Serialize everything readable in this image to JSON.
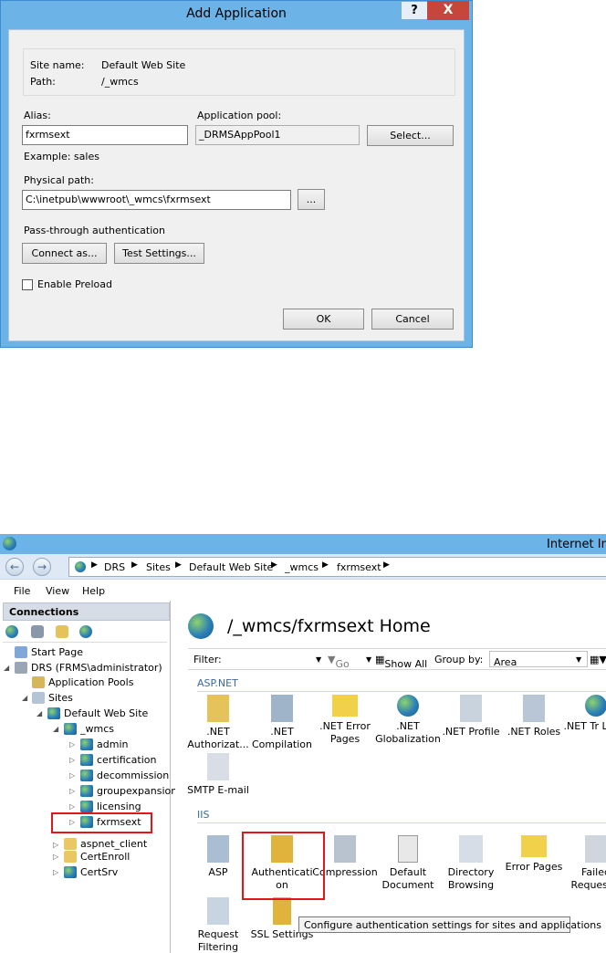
{
  "dialog": {
    "title": "Add Application",
    "help_label": "?",
    "close_label": "X",
    "site_name_label": "Site name:",
    "site_name_value": "Default Web Site",
    "path_label": "Path:",
    "path_value": "/_wmcs",
    "alias_label": "Alias:",
    "alias_value": "fxrmsext",
    "app_pool_label": "Application pool:",
    "app_pool_value": "_DRMSAppPool1",
    "select_button": "Select...",
    "example_text": "Example: sales",
    "physical_path_label": "Physical path:",
    "physical_path_value": "C:\\inetpub\\wwwroot\\_wmcs\\fxrmsext",
    "browse_button": "...",
    "passthrough_label": "Pass-through authentication",
    "connect_as_button": "Connect as...",
    "test_settings_button": "Test Settings...",
    "enable_preload_label": "Enable Preload",
    "enable_preload_checked": false,
    "ok_button": "OK",
    "cancel_button": "Cancel"
  },
  "iis": {
    "window_title": "Internet Inf",
    "breadcrumb": [
      "DRS",
      "Sites",
      "Default Web Site",
      "_wmcs",
      "fxrmsext"
    ],
    "menu": [
      "File",
      "View",
      "Help"
    ],
    "connections_title": "Connections",
    "tree": [
      {
        "label": "Start Page"
      },
      {
        "label": "DRS (FRMS\\administrator)"
      },
      {
        "label": "Application Pools"
      },
      {
        "label": "Sites"
      },
      {
        "label": "Default Web Site"
      },
      {
        "label": "_wmcs"
      },
      {
        "label": "admin"
      },
      {
        "label": "certification"
      },
      {
        "label": "decommission"
      },
      {
        "label": "groupexpansion"
      },
      {
        "label": "licensing"
      },
      {
        "label": "fxrmsext",
        "selected": true
      },
      {
        "label": "aspnet_client"
      },
      {
        "label": "CertEnroll"
      },
      {
        "label": "CertSrv"
      }
    ],
    "page_title": "/_wmcs/fxrmsext Home",
    "filter_label": "Filter:",
    "go_label": "Go",
    "show_all_label": "Show All",
    "group_by_label": "Group by:",
    "group_by_value": "Area",
    "aspnet_group": "ASP.NET",
    "aspnet_features": [
      ".NET Authorizat...",
      ".NET Compilation",
      ".NET Error Pages",
      ".NET Globalization",
      ".NET Profile",
      ".NET Roles",
      ".NET Tr Level"
    ],
    "smtp_feature": "SMTP E-mail",
    "iis_group": "IIS",
    "iis_features": [
      "ASP",
      "Authenticati on",
      "Compression",
      "Default Document",
      "Directory Browsing",
      "Error Pages",
      "Failed Request T"
    ],
    "iis_features_row2": [
      "Request Filtering",
      "SSL Settings"
    ],
    "tooltip": "Configure authentication settings for sites and applications",
    "colors": {
      "title_bar": "#6cb3e8",
      "highlight": "#e0161c",
      "close": "#c7463b"
    }
  }
}
